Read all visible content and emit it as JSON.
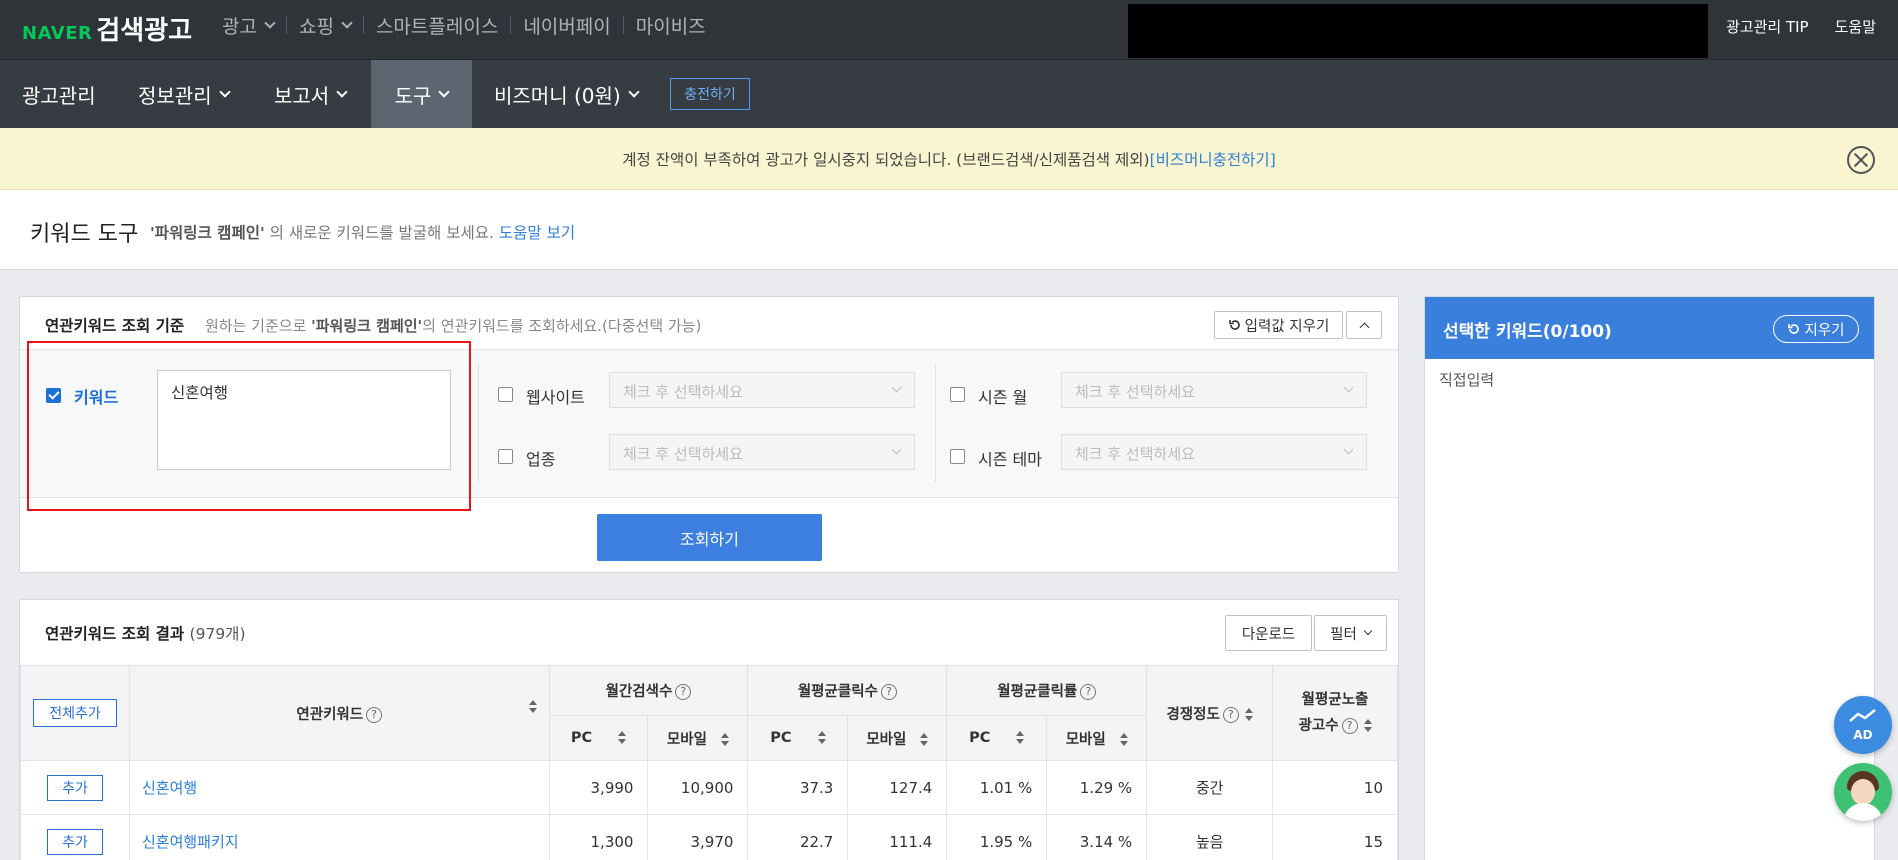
{
  "topbar": {
    "logo_naver": "NAVER",
    "logo_service": "검색광고",
    "nav": [
      {
        "label": "광고",
        "dropdown": true
      },
      {
        "label": "쇼핑",
        "dropdown": true
      },
      {
        "label": "스마트플레이스",
        "dropdown": false
      },
      {
        "label": "네이버페이",
        "dropdown": false
      },
      {
        "label": "마이비즈",
        "dropdown": false
      }
    ],
    "tip": "광고관리 TIP",
    "help": "도움말"
  },
  "mainnav": {
    "items": [
      {
        "label": "광고관리"
      },
      {
        "label": "정보관리"
      },
      {
        "label": "보고서"
      },
      {
        "label": "도구"
      },
      {
        "label": "비즈머니 (0원)"
      }
    ],
    "charge": "충전하기"
  },
  "alert": {
    "message": "계정 잔액이 부족하여 광고가 일시중지 되었습니다. (브랜드검색/신제품검색 제외)",
    "link": "[비즈머니충전하기]"
  },
  "page": {
    "title": "키워드 도구",
    "desc_quote": "'파워링크 캠페인'",
    "desc_text": " 의 새로운 키워드를 발굴해 보세요. ",
    "help_link": "도움말 보기"
  },
  "criteria": {
    "title": "연관키워드 조회 기준",
    "subtitle_pre": "원하는 기준으로 ",
    "subtitle_bold": "'파워링크 캠페인'",
    "subtitle_post": "의 연관키워드를 조회하세요.(다중선택 가능)",
    "reset_btn": "입력값 지우기",
    "keyword_label": "키워드",
    "keyword_value": "신혼여행",
    "website_label": "웹사이트",
    "industry_label": "업종",
    "season_month_label": "시즌 월",
    "season_theme_label": "시즌 테마",
    "select_placeholder": "체크 후 선택하세요",
    "search_btn": "조회하기"
  },
  "results": {
    "title": "연관키워드 조회 결과",
    "count": "(979개)",
    "download": "다운로드",
    "filter": "필터",
    "add_all": "전체추가",
    "headers": {
      "keyword": "연관키워드",
      "monthly_search": "월간검색수",
      "avg_clicks": "월평균클릭수",
      "avg_ctr": "월평균클릭률",
      "competition": "경쟁정도",
      "ad_count_1": "월평균노출",
      "ad_count_2": "광고수",
      "pc": "PC",
      "mobile": "모바일"
    },
    "add_label": "추가",
    "rows": [
      {
        "keyword": "신혼여행",
        "search_pc": "3,990",
        "search_mobile": "10,900",
        "click_pc": "37.3",
        "click_mobile": "127.4",
        "ctr_pc": "1.01 %",
        "ctr_mobile": "1.29 %",
        "competition": "중간",
        "ad_count": "10"
      },
      {
        "keyword": "신혼여행패키지",
        "search_pc": "1,300",
        "search_mobile": "3,970",
        "click_pc": "22.7",
        "click_mobile": "111.4",
        "ctr_pc": "1.95 %",
        "ctr_mobile": "3.14 %",
        "competition": "높음",
        "ad_count": "15"
      }
    ]
  },
  "selected": {
    "title": "선택한 키워드(0/100)",
    "clear": "지우기",
    "direct": "직접입력"
  },
  "floating": {
    "ad_label": "AD"
  }
}
